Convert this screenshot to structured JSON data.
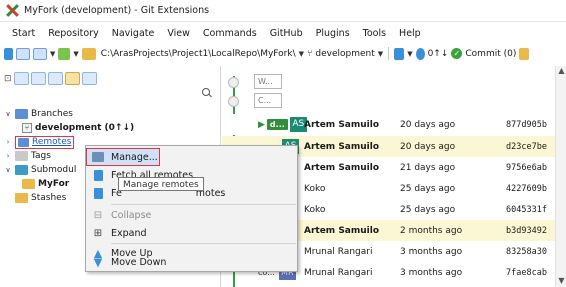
{
  "window": {
    "title": "MyFork (development) - Git Extensions"
  },
  "menu": [
    "Start",
    "Repository",
    "Navigate",
    "View",
    "Commands",
    "GitHub",
    "Plugins",
    "Tools",
    "Help"
  ],
  "toolbar": {
    "path": "C:\\ArasProjects\\Project1\\LocalRepo\\MyFork\\",
    "branch": "development",
    "sync_counts": "0↑↓",
    "commit_label": "Commit (0)"
  },
  "left_panel": {
    "tree": {
      "branches": "Branches",
      "current_branch": "development (0↑↓)",
      "remotes": "Remotes",
      "tags": "Tags",
      "submodules": "Submodul",
      "submodule_item": "MyFor",
      "stashes": "Stashes"
    }
  },
  "context_menu": {
    "items": [
      {
        "label": "Manage...",
        "icon": "manage-remotes-icon",
        "enabled": true
      },
      {
        "label": "Fetch all remotes",
        "icon": "fetch-icon",
        "enabled": true
      },
      {
        "label": "Fetch and prune all remotes",
        "icon": "fetch-prune-icon",
        "enabled": true
      },
      {
        "label": "Collapse",
        "icon": "collapse-icon",
        "enabled": false
      },
      {
        "label": "Expand",
        "icon": "expand-icon",
        "enabled": true
      },
      {
        "label": "Move Up",
        "icon": "move-up-icon",
        "enabled": true
      },
      {
        "label": "Move Down",
        "icon": "move-down-icon",
        "enabled": true
      }
    ],
    "tooltip": "Manage remotes",
    "fetch_prune_visible_prefix": "Fe",
    "fetch_prune_visible_suffix": "motes"
  },
  "grid": {
    "filters": [
      "W...",
      "C..."
    ],
    "ref_tag": "d...",
    "truncated_ref": "co...",
    "rows": [
      {
        "initials": "AS",
        "author": "Artem Samuilo",
        "date": "20 days ago",
        "hash": "877d905b",
        "avatar_color": "#1a8a73",
        "bold": true,
        "highlight": false
      },
      {
        "initials": "AS",
        "author": "Artem Samuilo",
        "date": "20 days ago",
        "hash": "d23ce7be",
        "avatar_color": "#1a8a73",
        "bold": true,
        "highlight": true
      },
      {
        "initials": "AS",
        "author": "Artem Samuilo",
        "date": "21 days ago",
        "hash": "9756e6ab",
        "avatar_color": "#1a8a73",
        "bold": true,
        "highlight": false
      },
      {
        "initials": "",
        "author": "Koko",
        "date": "25 days ago",
        "hash": "4227609b",
        "avatar_color": "#5b6fb5",
        "bold": false,
        "highlight": false
      },
      {
        "initials": "",
        "author": "Koko",
        "date": "25 days ago",
        "hash": "6045331f",
        "avatar_color": "#5b6fb5",
        "bold": false,
        "highlight": false
      },
      {
        "initials": "",
        "author": "Artem Samuilo",
        "date": "2 months ago",
        "hash": "b3d93492",
        "avatar_color": "#1a8a73",
        "bold": true,
        "highlight": true
      },
      {
        "initials": "",
        "author": "Mrunal Rangari",
        "date": "3 months ago",
        "hash": "83258a30",
        "avatar_color": "#5b6fb5",
        "bold": false,
        "highlight": false
      },
      {
        "initials": "MR",
        "author": "Mrunal Rangari",
        "date": "3 months ago",
        "hash": "7fae8cab",
        "avatar_color": "#5b6fb5",
        "bold": false,
        "highlight": false
      }
    ]
  }
}
